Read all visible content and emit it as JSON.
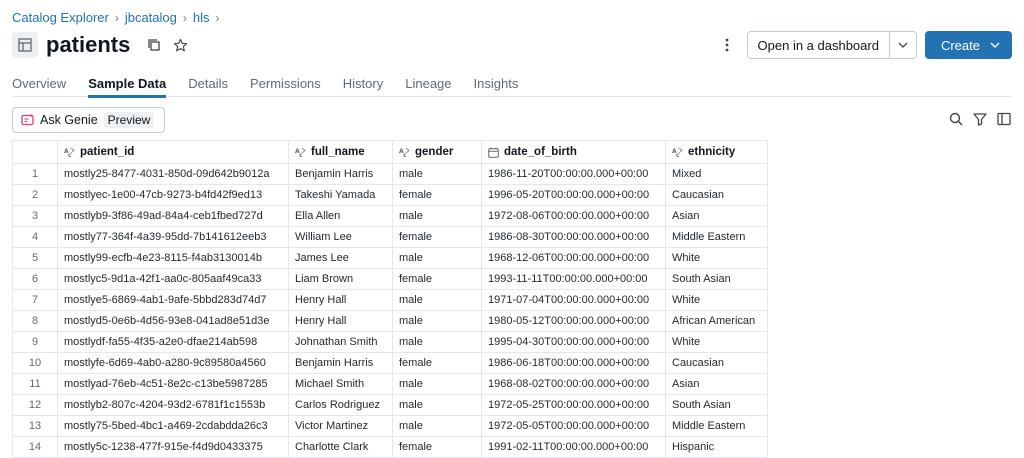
{
  "breadcrumb": [
    "Catalog Explorer",
    "jbcatalog",
    "hls"
  ],
  "breadcrumb_sep": "›",
  "title": "patients",
  "actions": {
    "open_dashboard": "Open in a dashboard",
    "create": "Create"
  },
  "tabs": [
    "Overview",
    "Sample Data",
    "Details",
    "Permissions",
    "History",
    "Lineage",
    "Insights"
  ],
  "active_tab": "Sample Data",
  "genie": {
    "label": "Ask Genie",
    "badge": "Preview"
  },
  "table": {
    "columns": [
      {
        "name": "patient_id",
        "type": "string"
      },
      {
        "name": "full_name",
        "type": "string"
      },
      {
        "name": "gender",
        "type": "string"
      },
      {
        "name": "date_of_birth",
        "type": "timestamp"
      },
      {
        "name": "ethnicity",
        "type": "string"
      }
    ],
    "rows": [
      [
        "1",
        "mostly25-8477-4031-850d-09d642b9012a",
        "Benjamin Harris",
        "male",
        "1986-11-20T00:00:00.000+00:00",
        "Mixed"
      ],
      [
        "2",
        "mostlyec-1e00-47cb-9273-b4fd42f9ed13",
        "Takeshi Yamada",
        "female",
        "1996-05-20T00:00:00.000+00:00",
        "Caucasian"
      ],
      [
        "3",
        "mostlyb9-3f86-49ad-84a4-ceb1fbed727d",
        "Ella Allen",
        "male",
        "1972-08-06T00:00:00.000+00:00",
        "Asian"
      ],
      [
        "4",
        "mostly77-364f-4a39-95dd-7b141612eeb3",
        "William Lee",
        "female",
        "1986-08-30T00:00:00.000+00:00",
        "Middle Eastern"
      ],
      [
        "5",
        "mostly99-ecfb-4e23-8115-f4ab3130014b",
        "James Lee",
        "male",
        "1968-12-06T00:00:00.000+00:00",
        "White"
      ],
      [
        "6",
        "mostlyc5-9d1a-42f1-aa0c-805aaf49ca33",
        "Liam Brown",
        "female",
        "1993-11-11T00:00:00.000+00:00",
        "South Asian"
      ],
      [
        "7",
        "mostlye5-6869-4ab1-9afe-5bbd283d74d7",
        "Henry Hall",
        "male",
        "1971-07-04T00:00:00.000+00:00",
        "White"
      ],
      [
        "8",
        "mostlyd5-0e6b-4d56-93e8-041ad8e51d3e",
        "Henry Hall",
        "male",
        "1980-05-12T00:00:00.000+00:00",
        "African American"
      ],
      [
        "9",
        "mostlydf-fa55-4f35-a2e0-dfae214ab598",
        "Johnathan Smith",
        "male",
        "1995-04-30T00:00:00.000+00:00",
        "White"
      ],
      [
        "10",
        "mostlyfe-6d69-4ab0-a280-9c89580a4560",
        "Benjamin Harris",
        "female",
        "1986-06-18T00:00:00.000+00:00",
        "Caucasian"
      ],
      [
        "11",
        "mostlyad-76eb-4c51-8e2c-c13be5987285",
        "Michael Smith",
        "male",
        "1968-08-02T00:00:00.000+00:00",
        "Asian"
      ],
      [
        "12",
        "mostlyb2-807c-4204-93d2-6781f1c1553b",
        "Carlos Rodriguez",
        "male",
        "1972-05-25T00:00:00.000+00:00",
        "South Asian"
      ],
      [
        "13",
        "mostly75-5bed-4bc1-a469-2cdabdda26c3",
        "Victor Martinez",
        "male",
        "1972-05-05T00:00:00.000+00:00",
        "Middle Eastern"
      ],
      [
        "14",
        "mostly5c-1238-477f-915e-f4d9d0433375",
        "Charlotte Clark",
        "female",
        "1991-02-11T00:00:00.000+00:00",
        "Hispanic"
      ]
    ]
  },
  "colors": {
    "accent": "#2272b4",
    "genie_icon": "#e23e8f"
  }
}
